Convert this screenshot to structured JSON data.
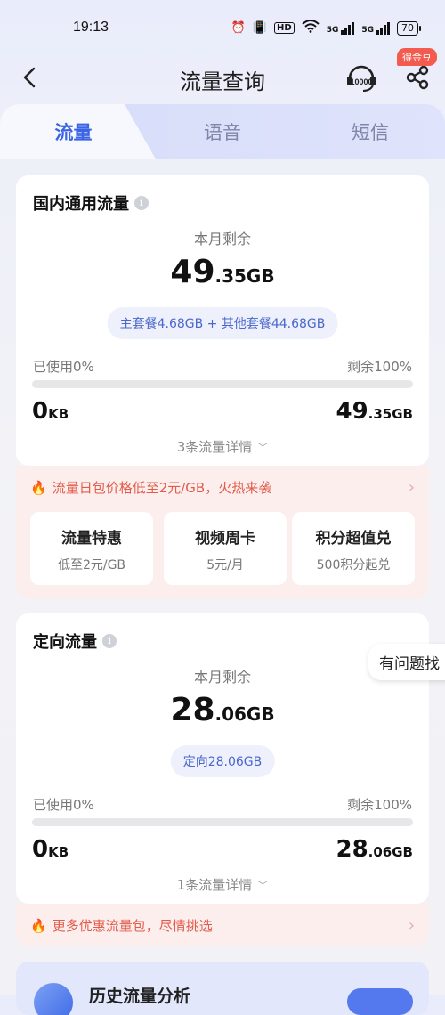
{
  "status": {
    "time": "19:13",
    "battery": "70",
    "hd": "HD",
    "net1": "5G",
    "net2": "5G"
  },
  "nav": {
    "title": "流量查询",
    "badge": "得金豆"
  },
  "tabs": [
    {
      "label": "流量",
      "active": true
    },
    {
      "label": "语音",
      "active": false
    },
    {
      "label": "短信",
      "active": false
    }
  ],
  "domestic": {
    "title": "国内通用流量",
    "remain_label": "本月剩余",
    "remain_num": "49",
    "remain_unit": ".35GB",
    "breakdown": "主套餐4.68GB + 其他套餐44.68GB",
    "used_label": "已使用0%",
    "left_label": "剩余100%",
    "used_percent": 0,
    "used_num": "0",
    "used_unit": "KB",
    "left_num": "49",
    "left_unit": ".35GB",
    "detail": "3条流量详情"
  },
  "promo1": {
    "text": "流量日包价格低至2元/GB，火热来袭",
    "offers": [
      {
        "title": "流量特惠",
        "sub": "低至2元/GB"
      },
      {
        "title": "视频周卡",
        "sub": "5元/月"
      },
      {
        "title": "积分超值兑",
        "sub": "500积分起兑"
      }
    ]
  },
  "directed": {
    "title": "定向流量",
    "remain_label": "本月剩余",
    "remain_num": "28",
    "remain_unit": ".06GB",
    "breakdown": "定向28.06GB",
    "used_label": "已使用0%",
    "left_label": "剩余100%",
    "used_percent": 0,
    "used_num": "0",
    "used_unit": "KB",
    "left_num": "28",
    "left_unit": ".06GB",
    "detail": "1条流量详情"
  },
  "promo2": {
    "text": "更多优惠流量包，尽情挑选"
  },
  "help": {
    "text": "有问题找"
  },
  "history": {
    "title": "历史流量分析"
  },
  "colors": {
    "accent": "#3b63e6",
    "promo_text": "#e25c4a",
    "promo_bg": "#fdeeee",
    "badge": "#f25b4e"
  }
}
